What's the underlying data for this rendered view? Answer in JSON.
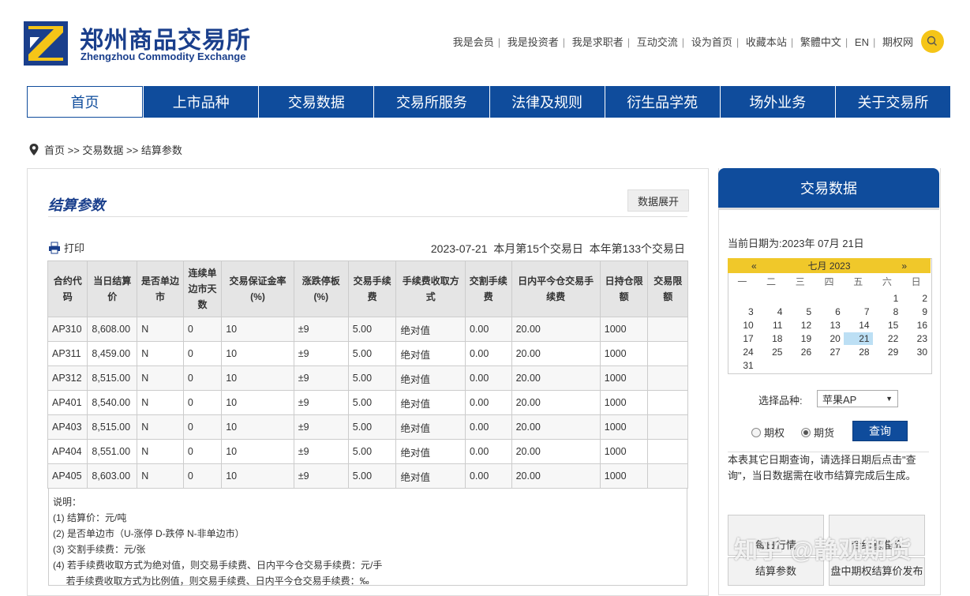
{
  "header": {
    "brand_cn": "郑州商品交易所",
    "brand_en": "Zhengzhou Commodity Exchange",
    "links": [
      "我是会员",
      "我是投资者",
      "我是求职者",
      "互动交流",
      "设为首页",
      "收藏本站",
      "繁體中文",
      "EN",
      "期权网"
    ]
  },
  "nav": [
    "首页",
    "上市品种",
    "交易数据",
    "交易所服务",
    "法律及规则",
    "衍生品学苑",
    "场外业务",
    "关于交易所"
  ],
  "breadcrumb": "首页 >> 交易数据 >> 结算参数",
  "main": {
    "title": "结算参数",
    "expand_label": "数据展开",
    "print_label": "打印",
    "date_info": "2023-07-21  本月第15个交易日  本年第133个交易日"
  },
  "table": {
    "headers": [
      "合约代码",
      "当日结算价",
      "是否单边市",
      "连续单边市天数",
      "交易保证金率(%)",
      "涨跌停板(%)",
      "交易手续费",
      "手续费收取方式",
      "交割手续费",
      "日内平今仓交易手续费",
      "日持仓限额",
      "交易限额"
    ],
    "rows": [
      [
        "AP310",
        "8,608.00",
        "N",
        "0",
        "10",
        "±9",
        "5.00",
        "绝对值",
        "0.00",
        "20.00",
        "1000",
        ""
      ],
      [
        "AP311",
        "8,459.00",
        "N",
        "0",
        "10",
        "±9",
        "5.00",
        "绝对值",
        "0.00",
        "20.00",
        "1000",
        ""
      ],
      [
        "AP312",
        "8,515.00",
        "N",
        "0",
        "10",
        "±9",
        "5.00",
        "绝对值",
        "0.00",
        "20.00",
        "1000",
        ""
      ],
      [
        "AP401",
        "8,540.00",
        "N",
        "0",
        "10",
        "±9",
        "5.00",
        "绝对值",
        "0.00",
        "20.00",
        "1000",
        ""
      ],
      [
        "AP403",
        "8,515.00",
        "N",
        "0",
        "10",
        "±9",
        "5.00",
        "绝对值",
        "0.00",
        "20.00",
        "1000",
        ""
      ],
      [
        "AP404",
        "8,551.00",
        "N",
        "0",
        "10",
        "±9",
        "5.00",
        "绝对值",
        "0.00",
        "20.00",
        "1000",
        ""
      ],
      [
        "AP405",
        "8,603.00",
        "N",
        "0",
        "10",
        "±9",
        "5.00",
        "绝对值",
        "0.00",
        "20.00",
        "1000",
        ""
      ]
    ]
  },
  "notes": {
    "title": "说明：",
    "lines": [
      "(1) 结算价：元/吨",
      "(2) 是否单边市（U-涨停 D-跌停 N-非单边市）",
      "(3) 交割手续费：元/张",
      "(4) 若手续费收取方式为绝对值，则交易手续费、日内平今仓交易手续费：元/手",
      "     若手续费收取方式为比例值，则交易手续费、日内平今仓交易手续费：‰"
    ]
  },
  "sidebar": {
    "title": "交易数据",
    "current_date": "当前日期为:2023年 07月 21日",
    "calendar": {
      "prev": "«",
      "month_label": "七月 2023",
      "next": "»",
      "weekdays": [
        "一",
        "二",
        "三",
        "四",
        "五",
        "六",
        "日"
      ],
      "days": [
        "",
        "",
        "",
        "",
        "",
        "1",
        "2",
        "3",
        "4",
        "5",
        "6",
        "7",
        "8",
        "9",
        "10",
        "11",
        "12",
        "13",
        "14",
        "15",
        "16",
        "17",
        "18",
        "19",
        "20",
        "21",
        "22",
        "23",
        "24",
        "25",
        "26",
        "27",
        "28",
        "29",
        "30",
        "31"
      ],
      "selected_day": "21"
    },
    "variety_label": "选择品种:",
    "variety_value": "苹果AP",
    "radio_option": "期权",
    "radio_futures": "期货",
    "query_label": "查询",
    "note": "本表其它日期查询，请选择日期后点击\"查询\"，当日数据需在收市结算完成后生成。",
    "boxes": [
      "每日行情",
      "合约基准价",
      "结算参数",
      "盘中期权结算价发布"
    ]
  },
  "watermark": "知乎 @静观期货",
  "colors": {
    "brand_blue": "#0f4c9c",
    "accent_yellow": "#f5c518"
  }
}
